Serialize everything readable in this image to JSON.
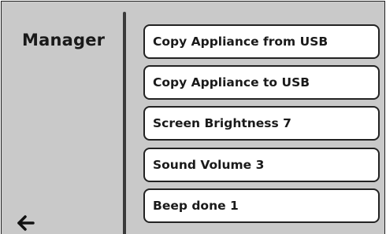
{
  "sidebar": {
    "title": "Manager",
    "back_icon": "left-arrow-icon"
  },
  "menu": {
    "items": [
      {
        "label": "Copy Appliance from USB"
      },
      {
        "label": "Copy Appliance to USB"
      },
      {
        "label": "Screen Brightness 7"
      },
      {
        "label": "Sound Volume 3"
      },
      {
        "label": "Beep done 1"
      }
    ]
  },
  "colors": {
    "background": "#c9c9c9",
    "button_fill": "#ffffff",
    "border": "#222222",
    "text": "#1a1a1a"
  }
}
